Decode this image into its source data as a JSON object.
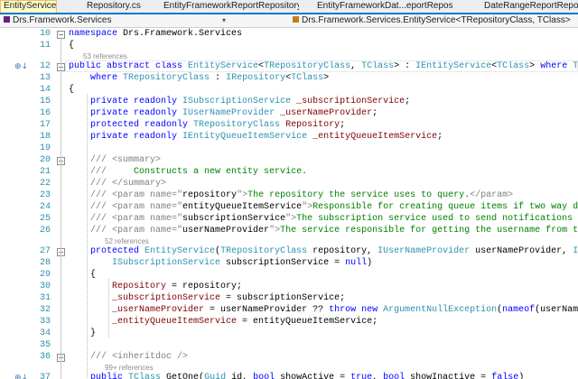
{
  "tabs": [
    {
      "label": "EntityService.cs",
      "active": true
    },
    {
      "label": "Repository.cs",
      "active": false
    },
    {
      "label": "EntityFrameworkReportRepository.cs",
      "active": false
    },
    {
      "label": "EntityFrameworkDat...eportRepository.cs",
      "active": false
    },
    {
      "label": "DateRangeReportRepository.cs",
      "active": false
    }
  ],
  "nav": {
    "project": "Drs.Framework.Services",
    "type": "Drs.Framework.Services.EntityService<TRepositoryClass, TClass>"
  },
  "lines": [
    {
      "n": "10",
      "segs": [
        [
          "kw",
          "namespace "
        ],
        [
          "tx",
          "Drs.Framework.Services"
        ]
      ]
    },
    {
      "n": "11",
      "segs": [
        [
          "tx",
          "{"
        ]
      ]
    },
    {
      "refs": "53 references"
    },
    {
      "n": "12",
      "segs": [
        [
          "kw",
          "public abstract class "
        ],
        [
          "ty",
          "EntityService"
        ],
        [
          "tx",
          "<"
        ],
        [
          "ty",
          "TRepositoryClass"
        ],
        [
          "tx",
          ", "
        ],
        [
          "ty",
          "TClass"
        ],
        [
          "tx",
          "> : "
        ],
        [
          "ty",
          "IEntityService"
        ],
        [
          "tx",
          "<"
        ],
        [
          "ty",
          "TClass"
        ],
        [
          "tx",
          "> "
        ],
        [
          "kw",
          "where "
        ],
        [
          "ty",
          "TClass"
        ]
      ]
    },
    {
      "n": "13",
      "segs": [
        [
          "tx",
          "    "
        ],
        [
          "kw",
          "where "
        ],
        [
          "ty",
          "TRepositoryClass"
        ],
        [
          "tx",
          " : "
        ],
        [
          "ty",
          "IRepository"
        ],
        [
          "tx",
          "<"
        ],
        [
          "ty",
          "TClass"
        ],
        [
          "tx",
          ">"
        ]
      ]
    },
    {
      "n": "14",
      "segs": [
        [
          "tx",
          "{"
        ]
      ]
    },
    {
      "n": "15",
      "segs": [
        [
          "tx",
          "    "
        ],
        [
          "kw",
          "private readonly "
        ],
        [
          "ty",
          "ISubscriptionService"
        ],
        [
          "tx",
          " "
        ],
        [
          "fd",
          "_subscriptionService"
        ],
        [
          "tx",
          ";"
        ]
      ]
    },
    {
      "n": "16",
      "segs": [
        [
          "tx",
          "    "
        ],
        [
          "kw",
          "private readonly "
        ],
        [
          "ty",
          "IUserNameProvider"
        ],
        [
          "tx",
          " "
        ],
        [
          "fd",
          "_userNameProvider"
        ],
        [
          "tx",
          ";"
        ]
      ]
    },
    {
      "n": "17",
      "segs": [
        [
          "tx",
          "    "
        ],
        [
          "kw",
          "protected readonly "
        ],
        [
          "ty",
          "TRepositoryClass"
        ],
        [
          "tx",
          " "
        ],
        [
          "fd",
          "Repository"
        ],
        [
          "tx",
          ";"
        ]
      ]
    },
    {
      "n": "18",
      "segs": [
        [
          "tx",
          "    "
        ],
        [
          "kw",
          "private readonly "
        ],
        [
          "ty",
          "IEntityQueueItemService"
        ],
        [
          "tx",
          " "
        ],
        [
          "fd",
          "_entityQueueItemService"
        ],
        [
          "tx",
          ";"
        ]
      ]
    },
    {
      "n": "19",
      "segs": []
    },
    {
      "n": "20",
      "segs": [
        [
          "tx",
          "    "
        ],
        [
          "xt",
          "/// <summary>"
        ]
      ]
    },
    {
      "n": "21",
      "segs": [
        [
          "tx",
          "    "
        ],
        [
          "xt",
          "/// "
        ],
        [
          "cm",
          "    Constructs a new entity service."
        ]
      ]
    },
    {
      "n": "22",
      "segs": [
        [
          "tx",
          "    "
        ],
        [
          "xt",
          "/// </summary>"
        ]
      ]
    },
    {
      "n": "23",
      "segs": [
        [
          "tx",
          "    "
        ],
        [
          "xt",
          "/// <param name=\""
        ],
        [
          "tx",
          "repository"
        ],
        [
          "xt",
          "\">"
        ],
        [
          "cm",
          "The repository the service uses to query."
        ],
        [
          "xt",
          "</param>"
        ]
      ]
    },
    {
      "n": "24",
      "segs": [
        [
          "tx",
          "    "
        ],
        [
          "xt",
          "/// <param name=\""
        ],
        [
          "tx",
          "entityQueueItemService"
        ],
        [
          "xt",
          "\">"
        ],
        [
          "cm",
          "Responsible for creating queue items if two way data sy"
        ]
      ]
    },
    {
      "n": "25",
      "segs": [
        [
          "tx",
          "    "
        ],
        [
          "xt",
          "/// <param name=\""
        ],
        [
          "tx",
          "subscriptionService"
        ],
        [
          "xt",
          "\">"
        ],
        [
          "cm",
          "The subscription service used to send notifications on ent"
        ]
      ]
    },
    {
      "n": "26",
      "segs": [
        [
          "tx",
          "    "
        ],
        [
          "xt",
          "/// <param name=\""
        ],
        [
          "tx",
          "userNameProvider"
        ],
        [
          "xt",
          "\">"
        ],
        [
          "cm",
          "The service responsible for getting the username from the cur"
        ]
      ]
    },
    {
      "refs": "52 references"
    },
    {
      "n": "27",
      "segs": [
        [
          "tx",
          "    "
        ],
        [
          "kw",
          "protected "
        ],
        [
          "ty",
          "EntityService"
        ],
        [
          "tx",
          "("
        ],
        [
          "ty",
          "TRepositoryClass"
        ],
        [
          "tx",
          " repository, "
        ],
        [
          "ty",
          "IUserNameProvider"
        ],
        [
          "tx",
          " userNameProvider, "
        ],
        [
          "ty",
          "IEntity"
        ]
      ]
    },
    {
      "n": "28",
      "segs": [
        [
          "tx",
          "        "
        ],
        [
          "ty",
          "ISubscriptionService"
        ],
        [
          "tx",
          " subscriptionService = "
        ],
        [
          "kw",
          "null"
        ],
        [
          "tx",
          ")"
        ]
      ]
    },
    {
      "n": "29",
      "segs": [
        [
          "tx",
          "    {"
        ]
      ]
    },
    {
      "n": "30",
      "segs": [
        [
          "tx",
          "        "
        ],
        [
          "fd",
          "Repository"
        ],
        [
          "tx",
          " = repository;"
        ]
      ]
    },
    {
      "n": "31",
      "segs": [
        [
          "tx",
          "        "
        ],
        [
          "fd",
          "_subscriptionService"
        ],
        [
          "tx",
          " = subscriptionService;"
        ]
      ]
    },
    {
      "n": "32",
      "segs": [
        [
          "tx",
          "        "
        ],
        [
          "fd",
          "_userNameProvider"
        ],
        [
          "tx",
          " = userNameProvider ?? "
        ],
        [
          "kw",
          "throw new "
        ],
        [
          "ty",
          "ArgumentNullException"
        ],
        [
          "tx",
          "("
        ],
        [
          "kw",
          "nameof"
        ],
        [
          "tx",
          "(userNameProvi"
        ]
      ]
    },
    {
      "n": "33",
      "segs": [
        [
          "tx",
          "        "
        ],
        [
          "fd",
          "_entityQueueItemService"
        ],
        [
          "tx",
          " = entityQueueItemService;"
        ]
      ]
    },
    {
      "n": "34",
      "segs": [
        [
          "tx",
          "    }"
        ]
      ]
    },
    {
      "n": "35",
      "segs": []
    },
    {
      "n": "36",
      "segs": [
        [
          "tx",
          "    "
        ],
        [
          "xt",
          "/// <inheritdoc />"
        ]
      ]
    },
    {
      "refs": "99+ references"
    },
    {
      "n": "37",
      "segs": [
        [
          "tx",
          "    "
        ],
        [
          "kw",
          "public "
        ],
        [
          "ty",
          "TClass"
        ],
        [
          "tx",
          " GetOne("
        ],
        [
          "ty",
          "Guid"
        ],
        [
          "tx",
          " id, "
        ],
        [
          "kw",
          "bool"
        ],
        [
          "tx",
          " showActive = "
        ],
        [
          "kw",
          "true"
        ],
        [
          "tx",
          ", "
        ],
        [
          "kw",
          "bool"
        ],
        [
          "tx",
          " showInactive = "
        ],
        [
          "kw",
          "false"
        ],
        [
          "tx",
          ")"
        ]
      ]
    }
  ]
}
